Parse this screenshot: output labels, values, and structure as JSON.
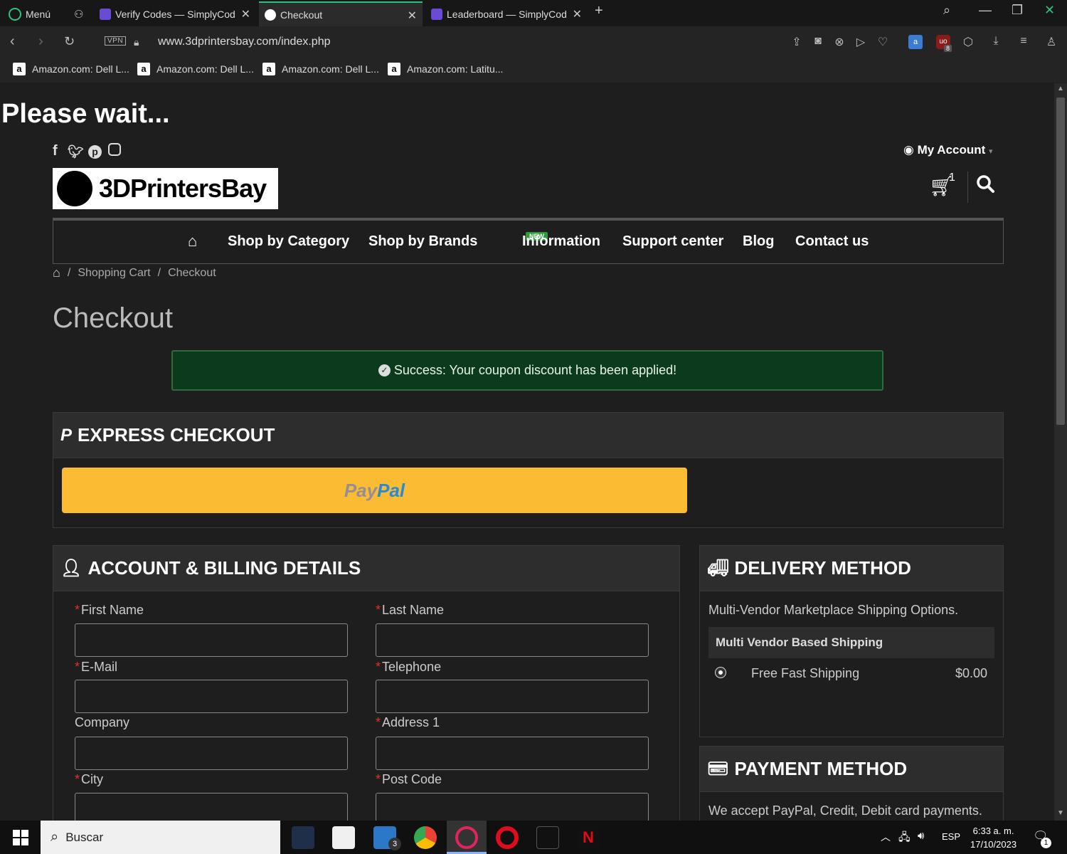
{
  "browser": {
    "menu_label": "Menú",
    "tabs": [
      {
        "title": "Verify Codes — SimplyCod",
        "active": false
      },
      {
        "title": "Checkout",
        "active": true
      },
      {
        "title": "Leaderboard — SimplyCod",
        "active": false
      }
    ],
    "url": "www.3dprintersbay.com/index.php",
    "vpn_label": "VPN",
    "bookmarks": [
      "Amazon.com: Dell L...",
      "Amazon.com: Dell L...",
      "Amazon.com: Dell L...",
      "Amazon.com: Latitu..."
    ],
    "extension_badge": "8"
  },
  "page": {
    "please_wait": "Please wait...",
    "my_account": "My Account",
    "logo_text": "3DPrintersBay",
    "cart_count": "1",
    "nav": {
      "items": [
        "Shop by Category",
        "Shop by Brands",
        "Information",
        "Support center",
        "Blog",
        "Contact us"
      ],
      "new_badge": "NEW"
    },
    "breadcrumb": [
      "Shopping Cart",
      "Checkout"
    ],
    "title": "Checkout",
    "alert": "Success: Your coupon discount has been applied!",
    "express": {
      "heading": "EXPRESS CHECKOUT",
      "paypal_part1": "Pay",
      "paypal_part2": "Pal"
    },
    "billing": {
      "heading": "ACCOUNT & BILLING DETAILS",
      "fields": {
        "first_name": "First Name",
        "last_name": "Last Name",
        "email": "E-Mail",
        "telephone": "Telephone",
        "company": "Company",
        "address1": "Address 1",
        "city": "City",
        "post_code": "Post Code"
      }
    },
    "delivery": {
      "heading": "DELIVERY METHOD",
      "description": "Multi-Vendor Marketplace Shipping Options.",
      "group": "Multi Vendor Based Shipping",
      "option": "Free Fast Shipping",
      "price": "$0.00"
    },
    "payment": {
      "heading": "PAYMENT METHOD",
      "description": "We accept PayPal, Credit, Debit card payments."
    }
  },
  "taskbar": {
    "search_placeholder": "Buscar",
    "mail_badge": "3",
    "language": "ESP",
    "time": "6:33 a. m.",
    "date": "17/10/2023",
    "notification_count": "1"
  },
  "colors": {
    "accent_green": "#2ec27e",
    "paypal_yellow": "#fbbc33",
    "success_bg": "#0c3a1c",
    "required_red": "#e03030"
  }
}
